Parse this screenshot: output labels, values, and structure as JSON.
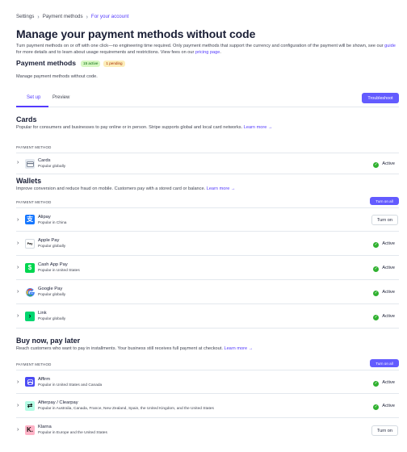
{
  "breadcrumb": {
    "items": [
      "Settings",
      "Payment methods"
    ],
    "current": "For your account"
  },
  "page_title": "Manage your payment methods without code",
  "intro": {
    "before_link": "Turn payment methods on or off with one click—no engineering time required. Only payment methods that support the currency and configuration of the payment will be shown, see our ",
    "guide_link": "guide",
    "middle": " for more details and to learn about usage requirements and restrictions. View fees on our ",
    "pricing_link": "pricing page",
    "end": "."
  },
  "payment_methods": {
    "title": "Payment methods",
    "active_badge": "15 active",
    "pending_badge": "1 pending",
    "subtitle": "Manage payment methods without code."
  },
  "tabs": [
    "Set up",
    "Preview"
  ],
  "troubleshoot_label": "Troubleshoot",
  "table_header": "PAYMENT METHOD",
  "turn_on_all_label": "Turn on all",
  "learn_more": "Learn more →",
  "sections": {
    "cards": {
      "title": "Cards",
      "desc": "Popular for consumers and businesses to pay online or in person. Stripe supports global and local card networks.",
      "rows": [
        {
          "name": "Cards",
          "desc": "Popular globally",
          "status": "Active"
        }
      ]
    },
    "wallets": {
      "title": "Wallets",
      "desc": "Improve conversion and reduce fraud on mobile. Customers pay with a stored card or balance.",
      "rows": [
        {
          "name": "Alipay",
          "desc": "Popular in China",
          "action": "Turn on"
        },
        {
          "name": "Apple Pay",
          "desc": "Popular globally",
          "status": "Active"
        },
        {
          "name": "Cash App Pay",
          "desc": "Popular in United States",
          "status": "Active"
        },
        {
          "name": "Google Pay",
          "desc": "Popular globally",
          "status": "Active"
        },
        {
          "name": "Link",
          "desc": "Popular globally",
          "status": "Active"
        }
      ]
    },
    "bnpl": {
      "title": "Buy now, pay later",
      "desc": "Reach customers who want to pay in installments. Your business still receives full payment at checkout.",
      "rows": [
        {
          "name": "Affirm",
          "desc": "Popular in United States and Canada",
          "status": "Active"
        },
        {
          "name": "Afterpay / Clearpay",
          "desc": "Popular in Australia, Canada, France, New Zealand, Spain, the United Kingdom, and the United States",
          "status": "Active"
        },
        {
          "name": "Klarna",
          "desc": "Popular in Europe and the United States",
          "action": "Turn on"
        }
      ]
    }
  },
  "icons": {
    "cards": "card-icon",
    "alipay": "alipay-logo-icon",
    "applepay": "apple-pay-logo-icon",
    "cashapp": "cash-app-logo-icon",
    "googlepay": "google-logo-icon",
    "link": "link-logo-icon",
    "affirm": "affirm-logo-icon",
    "afterpay": "afterpay-logo-icon",
    "klarna": "klarna-logo-icon",
    "status": "check-circle-icon",
    "expand": "chevron-right-icon"
  },
  "colors": {
    "accent": "#533afd",
    "button": "#635bff",
    "active_check": "#30b130",
    "alipay": "#1677ff",
    "cashapp": "#00d64f",
    "link": "#00d66f",
    "affirm": "#4a4af4",
    "afterpay": "#b2fce4",
    "klarna": "#ffb3c7"
  }
}
